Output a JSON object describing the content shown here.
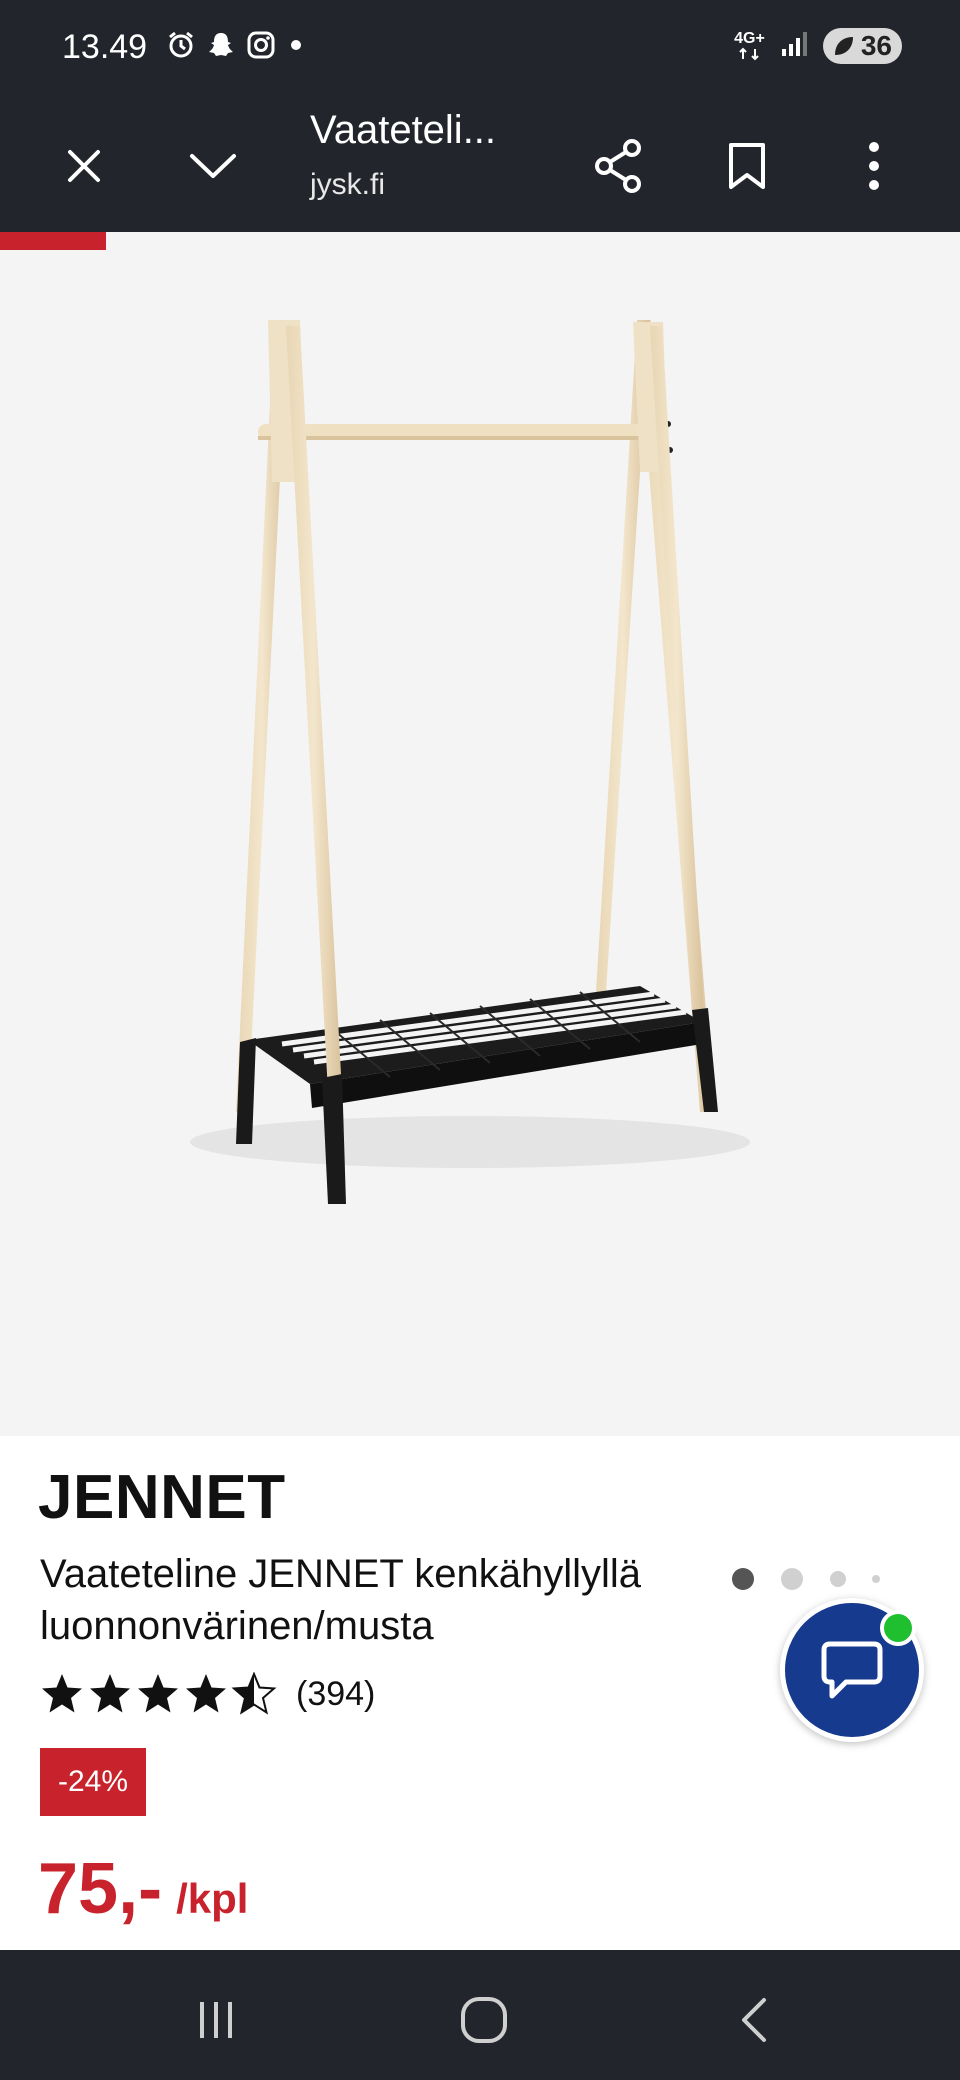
{
  "status_bar": {
    "time": "13.49",
    "network": "4G+",
    "battery": "36",
    "icons": [
      "alarm-icon",
      "snapchat-icon",
      "instagram-icon",
      "notification-dot-icon",
      "network-icon",
      "signal-icon",
      "battery-icon"
    ]
  },
  "browser": {
    "title": "Vaateteli...",
    "url": "jysk.fi",
    "icons": [
      "close-icon",
      "chevron-down-icon",
      "share-icon",
      "bookmark-icon",
      "more-vertical-icon"
    ]
  },
  "gallery": {
    "image_description": "clothes-rack-product-image",
    "slide_count": 4,
    "active_slide": 1
  },
  "product": {
    "brand": "JENNET",
    "name": "Vaateteline JENNET kenkähyllyllä luonnonvärinen/musta",
    "rating": 4.5,
    "rating_max": 5,
    "rating_count": "(394)",
    "discount": "-24%",
    "price": "75,-",
    "price_unit": "/kpl"
  },
  "colors": {
    "accent_red": "#c8232c",
    "chat_blue": "#163a8e",
    "online_green": "#1fbf2f",
    "bar_dark": "#22252b"
  },
  "nav_bar": {
    "icons": [
      "recent-apps-icon",
      "home-icon",
      "back-icon"
    ]
  }
}
